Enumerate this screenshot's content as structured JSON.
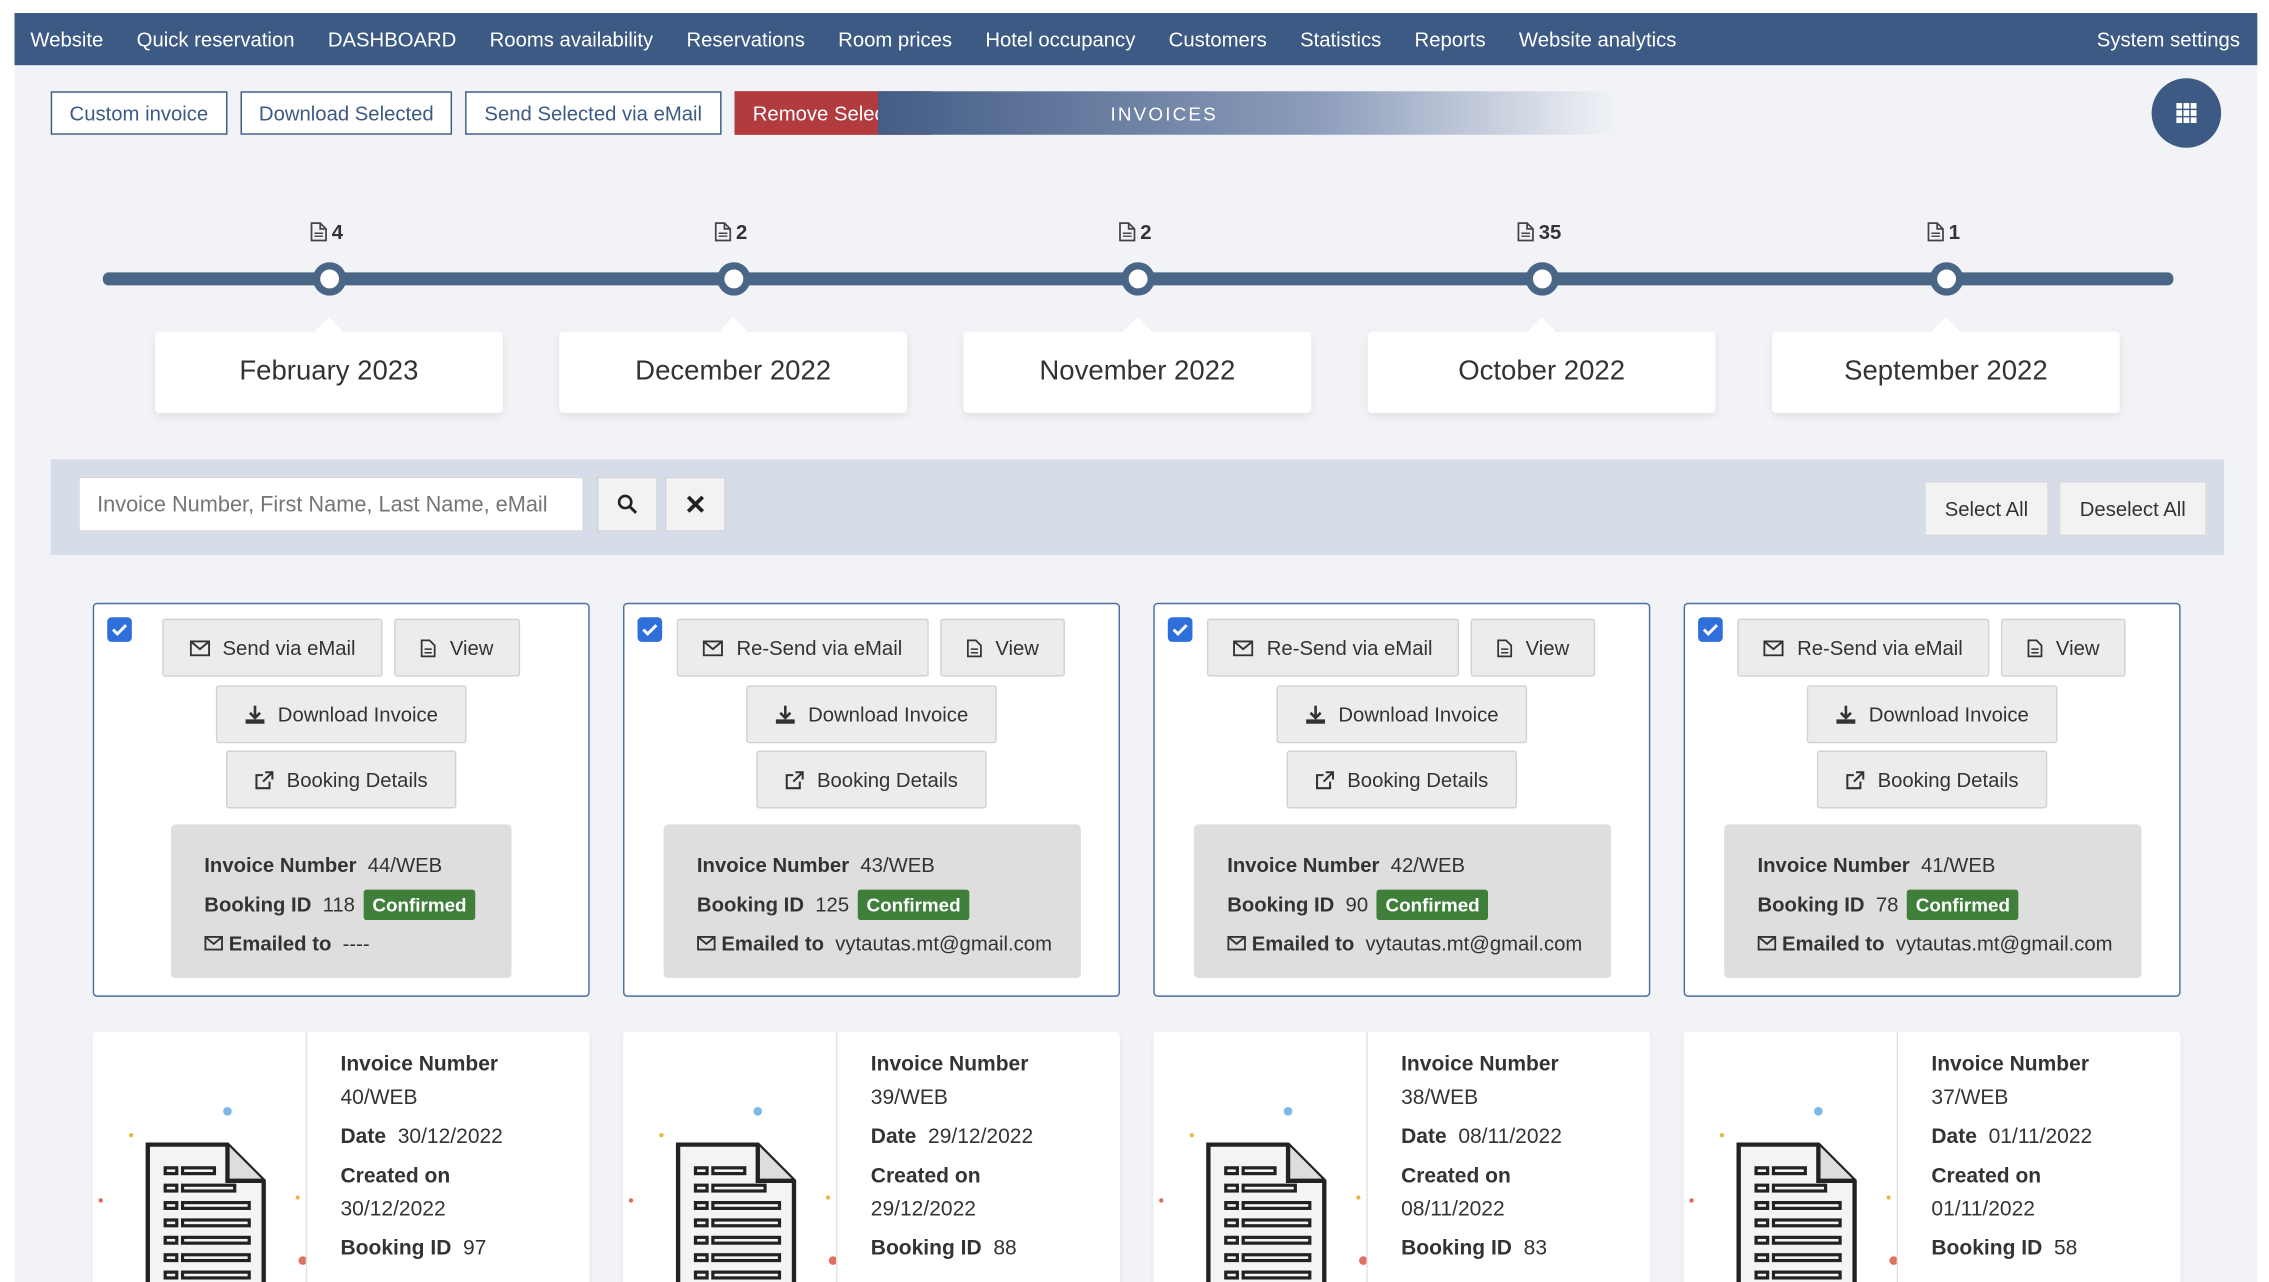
{
  "nav": {
    "items": [
      "Website",
      "Quick reservation",
      "DASHBOARD",
      "Rooms availability",
      "Reservations",
      "Room prices",
      "Hotel occupancy",
      "Customers",
      "Statistics",
      "Reports",
      "Website analytics"
    ],
    "right": "System settings"
  },
  "toolbar": {
    "custom_invoice": "Custom invoice",
    "download_selected": "Download Selected",
    "send_selected": "Send Selected via eMail",
    "remove_selected": "Remove Selected",
    "banner": "INVOICES",
    "grid_icon": "grid-icon"
  },
  "timeline": [
    {
      "count": "4",
      "label": "February 2023"
    },
    {
      "count": "2",
      "label": "December 2022"
    },
    {
      "count": "2",
      "label": "November 2022"
    },
    {
      "count": "35",
      "label": "October 2022"
    },
    {
      "count": "1",
      "label": "September 2022"
    }
  ],
  "search": {
    "placeholder": "Invoice Number, First Name, Last Name, eMail",
    "select_all": "Select All",
    "deselect_all": "Deselect All"
  },
  "labels": {
    "invoice_number": "Invoice Number",
    "booking_id": "Booking ID",
    "emailed_to": "Emailed to",
    "date": "Date",
    "created_on": "Created on",
    "view": "View",
    "download_invoice": "Download Invoice",
    "booking_details": "Booking Details"
  },
  "selected_invoices": [
    {
      "send_label": "Send via eMail",
      "invoice_number": "44/WEB",
      "booking_id": "118",
      "status": "Confirmed",
      "emailed_to": "----",
      "checked": true
    },
    {
      "send_label": "Re-Send via eMail",
      "invoice_number": "43/WEB",
      "booking_id": "125",
      "status": "Confirmed",
      "emailed_to": "vytautas.mt@gmail.com",
      "checked": true
    },
    {
      "send_label": "Re-Send via eMail",
      "invoice_number": "42/WEB",
      "booking_id": "90",
      "status": "Confirmed",
      "emailed_to": "vytautas.mt@gmail.com",
      "checked": true
    },
    {
      "send_label": "Re-Send via eMail",
      "invoice_number": "41/WEB",
      "booking_id": "78",
      "status": "Confirmed",
      "emailed_to": "vytautas.mt@gmail.com",
      "checked": true
    }
  ],
  "invoices": [
    {
      "invoice_number": "40/WEB",
      "date": "30/12/2022",
      "created_on": "30/12/2022",
      "booking_id": "97"
    },
    {
      "invoice_number": "39/WEB",
      "date": "29/12/2022",
      "created_on": "29/12/2022",
      "booking_id": "88"
    },
    {
      "invoice_number": "38/WEB",
      "date": "08/11/2022",
      "created_on": "08/11/2022",
      "booking_id": "83"
    },
    {
      "invoice_number": "37/WEB",
      "date": "01/11/2022",
      "created_on": "01/11/2022",
      "booking_id": "58"
    }
  ],
  "colors": {
    "nav": "#3c5a83",
    "danger": "#b23b3f",
    "confirmed": "#3f7f3a",
    "checkbox": "#2f6fdc"
  }
}
